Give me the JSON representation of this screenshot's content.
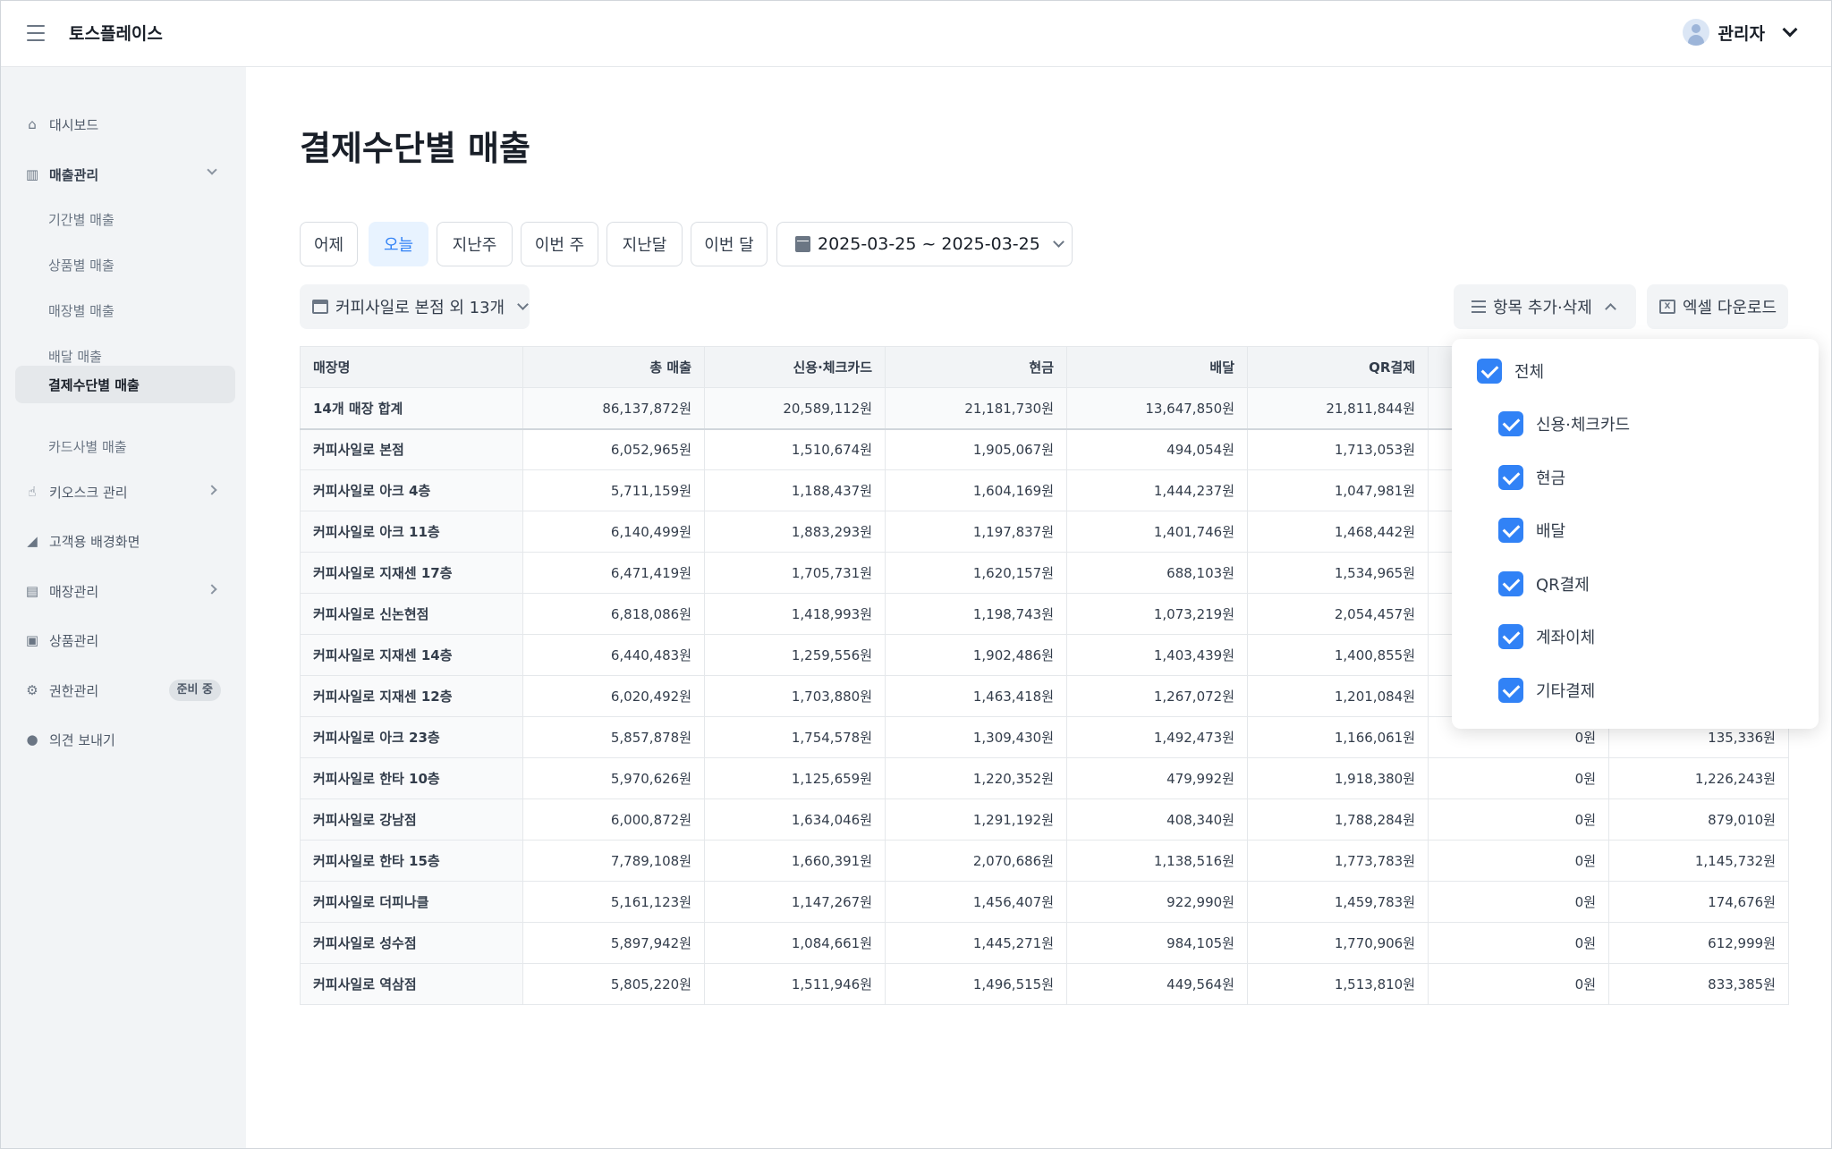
{
  "app": {
    "brand": "토스플레이스",
    "user_name": "관리자"
  },
  "sidebar": {
    "items": [
      {
        "label": "대시보드"
      },
      {
        "label": "매출관리"
      },
      {
        "label": "키오스크 관리"
      },
      {
        "label": "고객용 배경화면"
      },
      {
        "label": "매장관리"
      },
      {
        "label": "상품관리"
      },
      {
        "label": "권한관리"
      },
      {
        "label": "의견 보내기"
      }
    ],
    "sub_items": [
      {
        "label": "기간별 매출"
      },
      {
        "label": "상품별 매출"
      },
      {
        "label": "매장별 매출"
      },
      {
        "label": "배달 매출"
      },
      {
        "label": "결제수단별 매출"
      },
      {
        "label": "카드사별 매출"
      }
    ],
    "badge": "준비 중"
  },
  "main": {
    "title": "결제수단별 매출",
    "periods": [
      "어제",
      "오늘",
      "지난주",
      "이번 주",
      "지난달",
      "이번 달"
    ],
    "date_range": "2025-03-25 ~ 2025-03-25",
    "store_select": "커피사일로 본점 외 13개",
    "columns_button": "항목 추가·삭제",
    "excel_button": "엑셀 다운로드"
  },
  "table": {
    "headers": [
      "매장명",
      "총 매출",
      "신용·체크카드",
      "현금",
      "배달",
      "QR결제"
    ],
    "rows": [
      [
        "14개 매장 합계",
        "86,137,872원",
        "20,589,112원",
        "21,181,730원",
        "13,647,850원",
        "21,811,844원",
        "",
        ""
      ],
      [
        "커피사일로 본점",
        "6,052,965원",
        "1,510,674원",
        "1,905,067원",
        "494,054원",
        "1,713,053원",
        "",
        ""
      ],
      [
        "커피사일로 아크 4층",
        "5,711,159원",
        "1,188,437원",
        "1,604,169원",
        "1,444,237원",
        "1,047,981원",
        "",
        ""
      ],
      [
        "커피사일로 아크 11층",
        "6,140,499원",
        "1,883,293원",
        "1,197,837원",
        "1,401,746원",
        "1,468,442원",
        "",
        ""
      ],
      [
        "커피사일로 지재센 17층",
        "6,471,419원",
        "1,705,731원",
        "1,620,157원",
        "688,103원",
        "1,534,965원",
        "",
        ""
      ],
      [
        "커피사일로 신논현점",
        "6,818,086원",
        "1,418,993원",
        "1,198,743원",
        "1,073,219원",
        "2,054,457원",
        "",
        ""
      ],
      [
        "커피사일로 지재센 14층",
        "6,440,483원",
        "1,259,556원",
        "1,902,486원",
        "1,403,439원",
        "1,400,855원",
        "",
        ""
      ],
      [
        "커피사일로 지재센 12층",
        "6,020,492원",
        "1,703,880원",
        "1,463,418원",
        "1,267,072원",
        "1,201,084원",
        "",
        ""
      ],
      [
        "커피사일로 아크 23층",
        "5,857,878원",
        "1,754,578원",
        "1,309,430원",
        "1,492,473원",
        "1,166,061원",
        "0원",
        "135,336원"
      ],
      [
        "커피사일로 한타 10층",
        "5,970,626원",
        "1,125,659원",
        "1,220,352원",
        "479,992원",
        "1,918,380원",
        "0원",
        "1,226,243원"
      ],
      [
        "커피사일로 강남점",
        "6,000,872원",
        "1,634,046원",
        "1,291,192원",
        "408,340원",
        "1,788,284원",
        "0원",
        "879,010원"
      ],
      [
        "커피사일로 한타 15층",
        "7,789,108원",
        "1,660,391원",
        "2,070,686원",
        "1,138,516원",
        "1,773,783원",
        "0원",
        "1,145,732원"
      ],
      [
        "커피사일로 더피나클",
        "5,161,123원",
        "1,147,267원",
        "1,456,407원",
        "922,990원",
        "1,459,783원",
        "0원",
        "174,676원"
      ],
      [
        "커피사일로 성수점",
        "5,897,942원",
        "1,084,661원",
        "1,445,271원",
        "984,105원",
        "1,770,906원",
        "0원",
        "612,999원"
      ],
      [
        "커피사일로 역삼점",
        "5,805,220원",
        "1,511,946원",
        "1,496,515원",
        "449,564원",
        "1,513,810원",
        "0원",
        "833,385원"
      ]
    ]
  },
  "dropdown": {
    "options": [
      {
        "label": "전체",
        "checked": true
      },
      {
        "label": "신용·체크카드",
        "checked": true
      },
      {
        "label": "현금",
        "checked": true
      },
      {
        "label": "배달",
        "checked": true
      },
      {
        "label": "QR결제",
        "checked": true
      },
      {
        "label": "계좌이체",
        "checked": true
      },
      {
        "label": "기타결제",
        "checked": true
      }
    ]
  },
  "colors": {
    "accent": "#3182f6",
    "sidebar_bg": "#f2f4f6",
    "active_pill_bg": "#e8f3ff"
  }
}
